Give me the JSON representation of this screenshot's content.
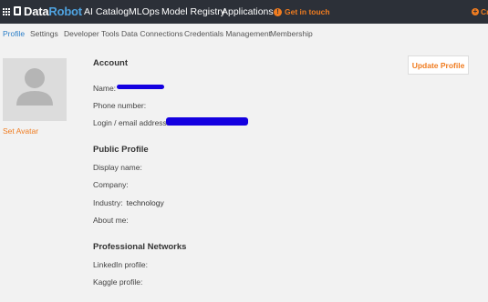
{
  "topbar": {
    "brand_a": "Data",
    "brand_b": "Robot",
    "nav": [
      "AI Catalog",
      "MLOps",
      "Model Registry",
      "Applications"
    ],
    "get_in_touch": "Get in touch",
    "right_label": "Cr",
    "accent_color": "#f07c20",
    "bg_color": "#2c3038"
  },
  "subnav": {
    "items": [
      "Profile",
      "Settings",
      "Developer Tools",
      "Data Connections",
      "Credentials Management",
      "Membership"
    ],
    "active": "Profile"
  },
  "avatar": {
    "set_label": "Set Avatar"
  },
  "update_button": "Update Profile",
  "account": {
    "title": "Account",
    "name_label": "Name:",
    "phone_label": "Phone number:",
    "login_label": "Login / email address:"
  },
  "public_profile": {
    "title": "Public Profile",
    "display_name_label": "Display name:",
    "company_label": "Company:",
    "industry_label": "Industry:",
    "industry_value": "technology",
    "about_label": "About me:"
  },
  "professional": {
    "title": "Professional Networks",
    "linkedin_label": "LinkedIn profile:",
    "kaggle_label": "Kaggle profile:"
  }
}
